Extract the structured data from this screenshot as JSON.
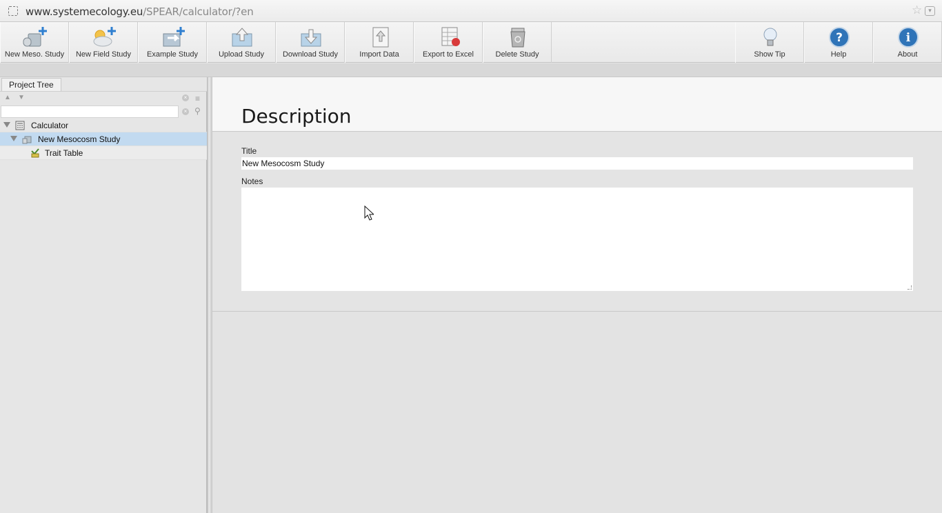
{
  "browser": {
    "url_host": "www.systemecology.eu",
    "url_path": "/SPEAR/calculator/?en"
  },
  "toolbar": {
    "buttons": [
      {
        "label": "New Meso. Study",
        "icon": "new-mesocosm-study-icon"
      },
      {
        "label": "New Field Study",
        "icon": "new-field-study-icon"
      },
      {
        "label": "Example Study",
        "icon": "example-study-icon"
      },
      {
        "label": "Upload Study",
        "icon": "upload-study-icon"
      },
      {
        "label": "Download Study",
        "icon": "download-study-icon"
      },
      {
        "label": "Import Data",
        "icon": "import-data-icon"
      },
      {
        "label": "Export to Excel",
        "icon": "export-excel-icon"
      },
      {
        "label": "Delete Study",
        "icon": "delete-study-icon"
      }
    ],
    "right_buttons": [
      {
        "label": "Show Tip",
        "icon": "lightbulb-icon"
      },
      {
        "label": "Help",
        "icon": "help-icon"
      },
      {
        "label": "About",
        "icon": "info-icon"
      }
    ]
  },
  "sidebar": {
    "tab_label": "Project Tree",
    "filter_value": "",
    "tree": [
      {
        "label": "Calculator",
        "level": 0,
        "expanded": true,
        "selected": false
      },
      {
        "label": "New Mesocosm Study",
        "level": 1,
        "expanded": true,
        "selected": true
      },
      {
        "label": "Trait Table",
        "level": 2,
        "expanded": false,
        "selected": false
      }
    ]
  },
  "main": {
    "heading": "Description",
    "title_label": "Title",
    "title_value": "New Mesocosm Study",
    "notes_label": "Notes",
    "notes_value": ""
  },
  "colors": {
    "selection": "#c2daf0",
    "help_blue": "#2f74b8"
  }
}
